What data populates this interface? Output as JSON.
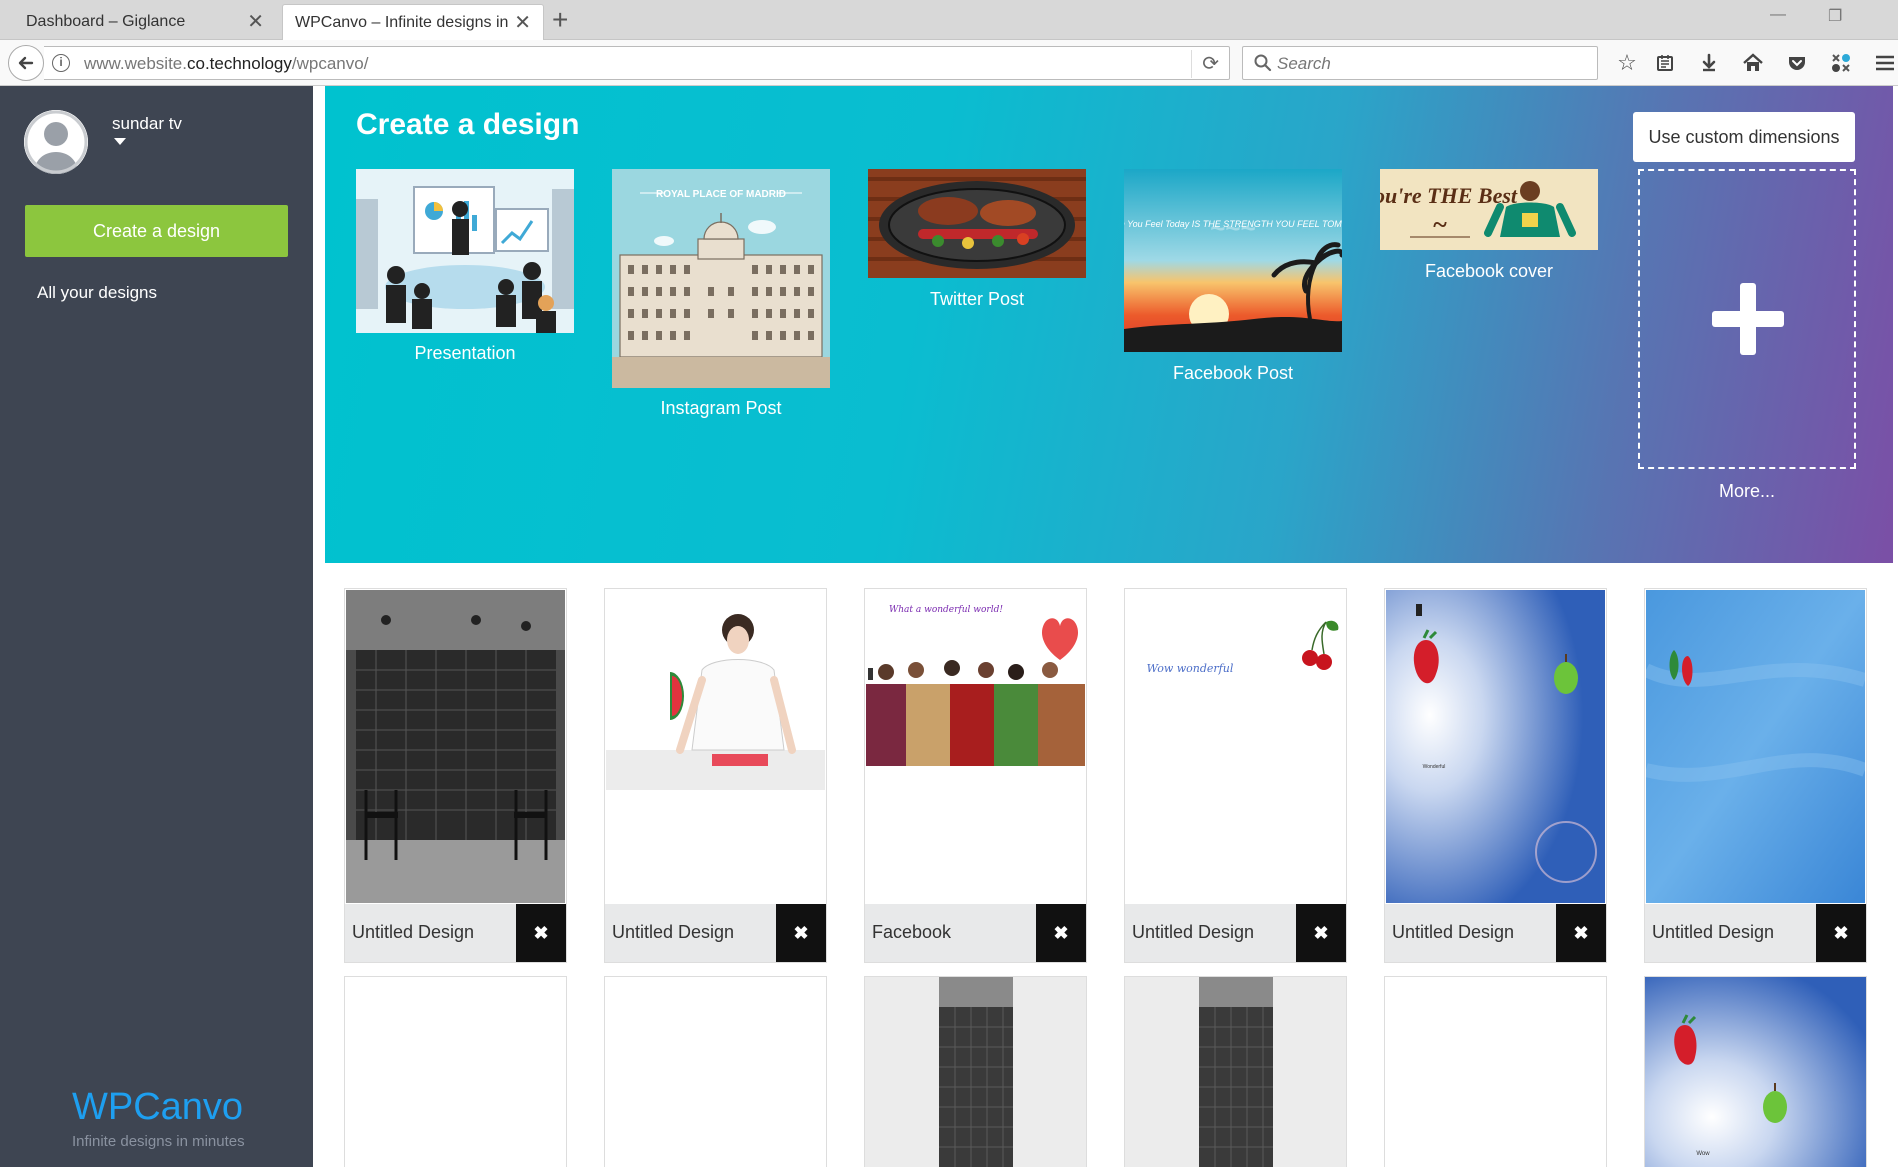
{
  "browser": {
    "tabs": [
      {
        "title": "Dashboard – Giglance"
      },
      {
        "title": "WPCanvo – Infinite designs in m"
      }
    ],
    "url_prefix": "www.website.",
    "url_domain": "co.technology",
    "url_path": "/wpcanvo/",
    "search_placeholder": "Search"
  },
  "sidebar": {
    "user_name": "sundar tv",
    "create_label": "Create a design",
    "all_designs_label": "All your designs",
    "brand": "WPCanvo",
    "tagline": "Infinite designs in minutes",
    "accent_color": "#8cc63e",
    "brand_color": "#1e9ff0"
  },
  "hero": {
    "title": "Create a design",
    "templates": [
      {
        "label": "Presentation",
        "thumb_text": ""
      },
      {
        "label": "Instagram Post",
        "thumb_text": "ROYAL PLACE OF MADRID"
      },
      {
        "label": "Twitter Post",
        "thumb_text": ""
      },
      {
        "label": "Facebook Post",
        "thumb_text": "The Pain You Feel Today IS THE STRENGTH YOU FEEL TOMORROW"
      },
      {
        "label": "Facebook cover",
        "thumb_text": "You're THE Best"
      }
    ],
    "custom_dimensions_label": "Use custom dimensions",
    "more_label": "More..."
  },
  "designs": {
    "delete_symbol": "✖",
    "row1": [
      {
        "label": "Untitled Design"
      },
      {
        "label": "Untitled Design"
      },
      {
        "label": "Facebook"
      },
      {
        "label": "Untitled Design"
      },
      {
        "label": "Untitled Design"
      },
      {
        "label": "Untitled Design"
      }
    ],
    "card_texts": {
      "facebook_script": "What a wonderful world!",
      "wow_wonderful": "Wow wonderful",
      "tiny_caption": "Wonderful",
      "tiny_caption2": "Wow"
    }
  }
}
